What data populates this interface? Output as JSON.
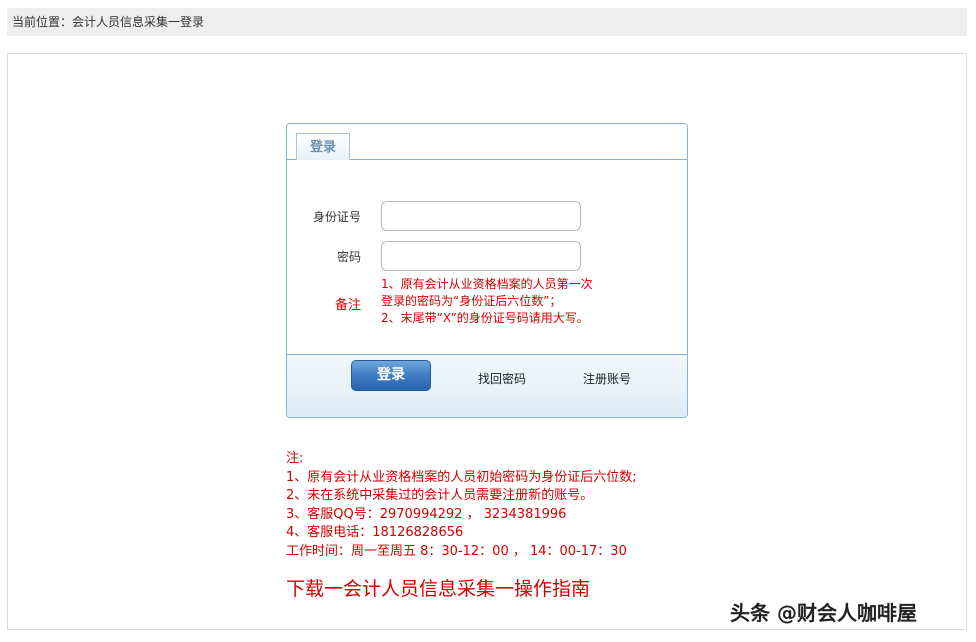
{
  "breadcrumb": {
    "text": "当前位置：会计人员信息采集一登录"
  },
  "login": {
    "tab_label": "登录",
    "id_label": "身份证号",
    "id_value": "",
    "password_label": "密码",
    "password_value": "",
    "note_label": "备注",
    "note_lines": [
      "1、原有会计从业资格档案的人员第一次",
      "登录的密码为“身份证后六位数”；",
      "2、末尾带“X”的身份证号码请用大写。"
    ],
    "login_button": "登录",
    "forgot_password": "找回密码",
    "register": "注册账号"
  },
  "notes": {
    "title": "注:",
    "lines": [
      "1、原有会计从业资格档案的人员初始密码为身份证后六位数;",
      "2、未在系统中采集过的会计人员需要注册新的账号。",
      "3、客服QQ号：2970994292 ， 3234381996",
      "4、客服电话：18126828656",
      "工作时间：周一至周五 8：30-12：00 ， 14：00-17：30"
    ]
  },
  "download_link": "下载一会计人员信息采集一操作指南",
  "watermark": "头条 @财会人咖啡屋",
  "colors": {
    "accent_red": "#d40000",
    "border_blue": "#8db2d1",
    "button_blue": "#3d7cc4"
  }
}
